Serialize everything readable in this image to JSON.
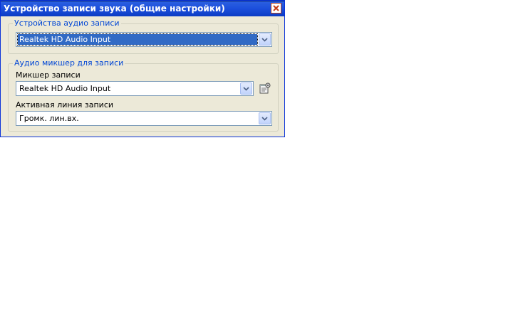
{
  "window": {
    "title": "Устройство записи звука (общие настройки)"
  },
  "audio_devices": {
    "legend": "Устройства аудио записи",
    "selected": "Realtek HD Audio Input"
  },
  "mixer_group": {
    "legend": "Аудио микшер для записи",
    "mixer_label": "Микшер записи",
    "mixer_value": "Realtek HD Audio Input",
    "line_label": "Активная линия записи",
    "line_value": "Громк. лин.вх."
  },
  "icons": {
    "close": "close-icon",
    "dropdown": "chevron-down-icon",
    "settings": "properties-icon"
  },
  "colors": {
    "title_bar": "#0b3cc4",
    "legend_text": "#0046d5",
    "dialog_bg": "#ece9d8",
    "selection": "#316ac5"
  }
}
